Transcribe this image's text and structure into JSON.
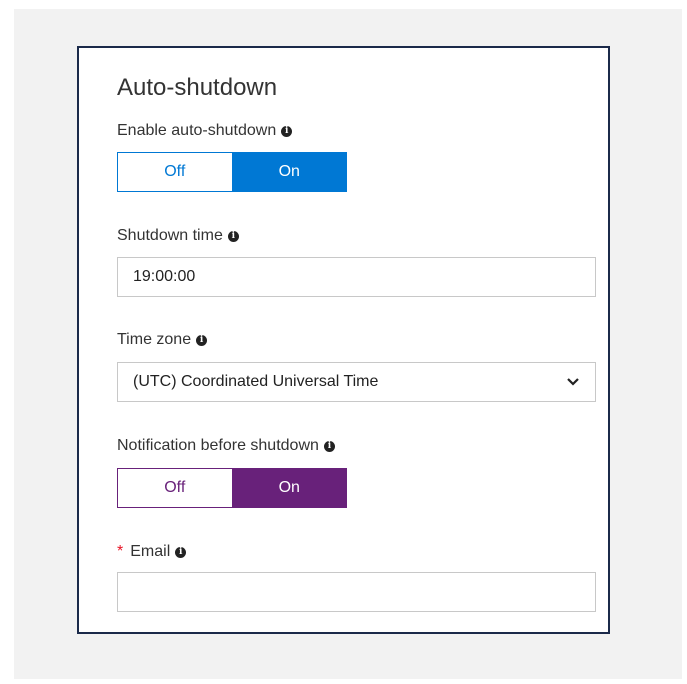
{
  "panel": {
    "title": "Auto-shutdown"
  },
  "enable_auto_shutdown": {
    "label": "Enable auto-shutdown",
    "off_label": "Off",
    "on_label": "On",
    "selected": "On"
  },
  "shutdown_time": {
    "label": "Shutdown time",
    "value": "19:00:00"
  },
  "time_zone": {
    "label": "Time zone",
    "selected": "(UTC) Coordinated Universal Time"
  },
  "notification": {
    "label": "Notification before shutdown",
    "off_label": "Off",
    "on_label": "On",
    "selected": "On"
  },
  "email": {
    "required_mark": "*",
    "label": "Email",
    "value": ""
  },
  "colors": {
    "toggle_primary": "#0078d4",
    "toggle_notification": "#68217a",
    "required": "#e81123"
  },
  "icons": [
    "info-icon",
    "chevron-down-icon"
  ]
}
